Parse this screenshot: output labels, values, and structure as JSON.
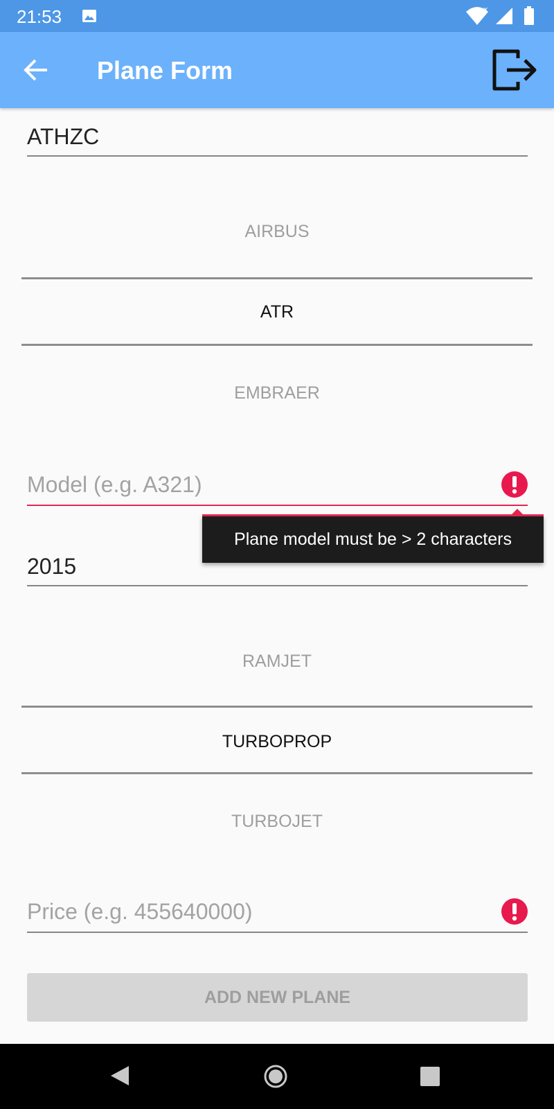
{
  "status_bar": {
    "time": "21:53",
    "icons": [
      "image-notification-icon",
      "wifi-icon",
      "signal-icon",
      "battery-icon"
    ]
  },
  "app_bar": {
    "title": "Plane Form",
    "back_icon": "arrow-left-icon",
    "logout_icon": "logout-icon",
    "background": "#6cb1fb"
  },
  "form": {
    "registration_value": "ATHZC",
    "manufacturer_options": [
      "AIRBUS",
      "ATR",
      "EMBRAER"
    ],
    "manufacturer_selected": "ATR",
    "model_placeholder": "Model (e.g. A321)",
    "model_error": "Plane model must be > 2 characters",
    "year_value": "2015",
    "engine_options": [
      "RAMJET",
      "TURBOPROP",
      "TURBOJET"
    ],
    "engine_selected": "TURBOPROP",
    "price_placeholder": "Price (e.g. 455640000)",
    "submit_label": "ADD NEW PLANE"
  },
  "colors": {
    "error": "#e0264f",
    "status_bar": "#4d97e6"
  },
  "nav_bar": {
    "icons": [
      "nav-back-icon",
      "nav-home-icon",
      "nav-recents-icon"
    ]
  }
}
